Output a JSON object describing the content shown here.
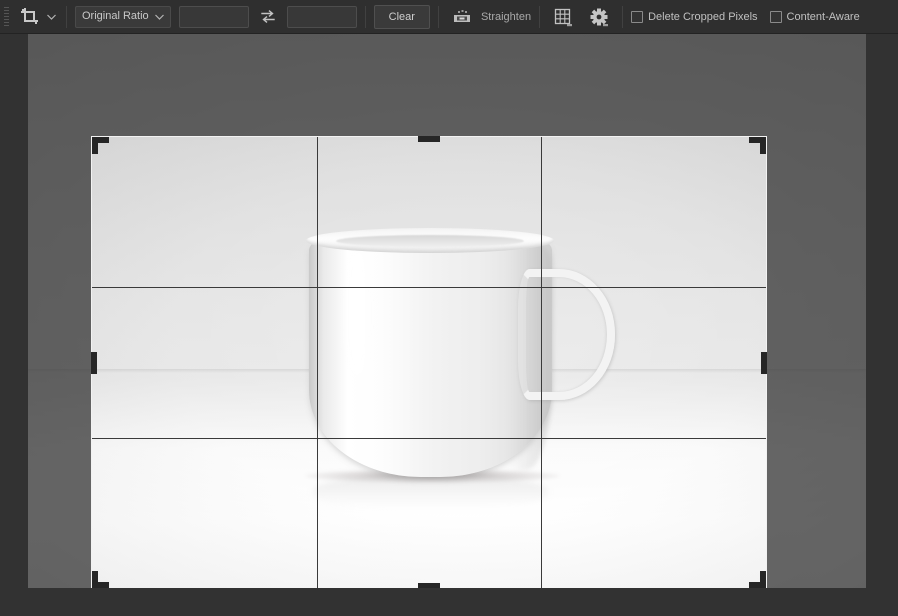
{
  "app": {
    "tool": "Crop Tool",
    "title": "Photoshop Crop Tool Options Bar"
  },
  "options_bar": {
    "tool_icon": "crop-tool-icon",
    "tool_preset_chevron": "chevron-down-icon",
    "ratio_select": {
      "value": "Original Ratio",
      "chevron": "chevron-down-icon"
    },
    "width_field": {
      "value": "",
      "placeholder": ""
    },
    "swap_button": {
      "icon": "swap-arrows-icon",
      "label": "Swaps Height and Width"
    },
    "height_field": {
      "value": "",
      "placeholder": ""
    },
    "clear_button": {
      "label": "Clear"
    },
    "straighten": {
      "icon": "straighten-level-icon",
      "label": "Straighten"
    },
    "overlay_button": {
      "icon": "grid-overlay-icon",
      "chevron": "chevron-down-small-icon"
    },
    "settings_button": {
      "icon": "gear-icon",
      "chevron": "chevron-down-small-icon"
    },
    "checkboxes": [
      {
        "id": "delete-cropped-pixels",
        "label": "Delete Cropped Pixels",
        "checked": false
      },
      {
        "id": "content-aware",
        "label": "Content-Aware",
        "checked": false
      }
    ]
  },
  "canvas": {
    "document_name": "",
    "crop_overlay": {
      "type": "rule-of-thirds",
      "columns": 3,
      "rows": 3,
      "handles": [
        "top-left",
        "top-center",
        "top-right",
        "middle-left",
        "middle-right",
        "bottom-left",
        "bottom-center",
        "bottom-right"
      ]
    },
    "image_subject": "white ceramic mug on light surface"
  },
  "colors": {
    "chrome_bg": "#2f2f2f",
    "workspace_bg": "#2d2d2d",
    "canvas_bg": "#5e5e5e",
    "panel_bg": "#323232",
    "text": "#c8c8c8",
    "handle": "#262626",
    "crop_border": "#f2f2f2",
    "guide": "#3a3a3a"
  }
}
